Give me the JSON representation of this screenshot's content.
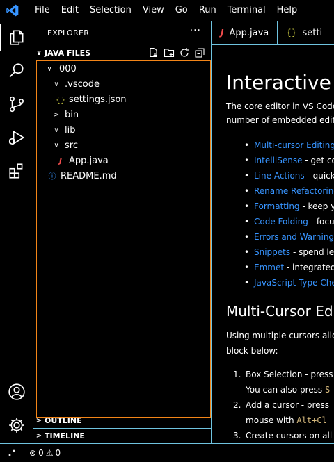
{
  "menu": [
    "File",
    "Edit",
    "Selection",
    "View",
    "Go",
    "Run",
    "Terminal",
    "Help"
  ],
  "sidebar": {
    "title": "EXPLORER",
    "more": "···",
    "section": "JAVA FILES",
    "tree": [
      {
        "label": "000",
        "depth": 0,
        "kind": "folder-open"
      },
      {
        "label": ".vscode",
        "depth": 1,
        "kind": "folder-open"
      },
      {
        "label": "settings.json",
        "depth": 2,
        "kind": "json"
      },
      {
        "label": "bin",
        "depth": 1,
        "kind": "folder-closed"
      },
      {
        "label": "lib",
        "depth": 1,
        "kind": "folder-open"
      },
      {
        "label": "src",
        "depth": 1,
        "kind": "folder-open"
      },
      {
        "label": "App.java",
        "depth": 2,
        "kind": "java"
      },
      {
        "label": "README.md",
        "depth": 1,
        "kind": "info"
      }
    ],
    "outline": "OUTLINE",
    "timeline": "TIMELINE"
  },
  "tabs": [
    {
      "label": "App.java",
      "icon": "J"
    },
    {
      "label": "setti",
      "icon": "{}"
    }
  ],
  "doc": {
    "h1": "Interactive Ec",
    "intro1": "The core editor in VS Code",
    "intro2": "number of embedded edito",
    "features": [
      {
        "link": "Multi-cursor Editing",
        "rest": ""
      },
      {
        "link": "IntelliSense",
        "rest": " - get coc"
      },
      {
        "link": "Line Actions",
        "rest": " - quickl"
      },
      {
        "link": "Rename Refactoring",
        "rest": ""
      },
      {
        "link": "Formatting",
        "rest": " - keep yo"
      },
      {
        "link": "Code Folding",
        "rest": " - focus"
      },
      {
        "link": "Errors and Warnings",
        "rest": ""
      },
      {
        "link": "Snippets",
        "rest": " - spend les"
      },
      {
        "link": "Emmet",
        "rest": " - integrated"
      },
      {
        "link": "JavaScript Type Chec",
        "rest": ""
      }
    ],
    "h2": "Multi-Cursor Edit",
    "p2a": "Using multiple cursors allov",
    "p2b": "block below:",
    "step1": "Box Selection - press",
    "step1b_pre": "You can also press ",
    "step1b_code": "S",
    "step2": "Add a cursor - press",
    "step2b_pre": "mouse with ",
    "step2b_kbd": "Alt+Cl",
    "step3": "Create cursors on all"
  },
  "status": {
    "errors": "0",
    "warnings": "0"
  },
  "colors": {
    "accent": "#6fc3df",
    "focus": "#f38518",
    "link": "#3794ff",
    "java": "#f14c4c",
    "json": "#cbcb41",
    "info": "#3794ff"
  }
}
